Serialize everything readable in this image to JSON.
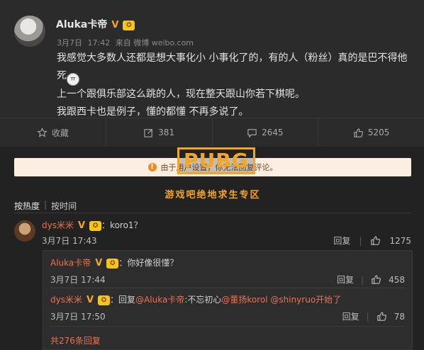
{
  "post": {
    "author": "Aluka卡帝",
    "verified_badge": "V",
    "game_badge": "✪",
    "date": "3月7日",
    "time": "17:42",
    "source": "来自 微博 weibo.com",
    "lines": [
      "我感觉大多数人还都是想大事化小 小事化了的，有的人（粉丝）真的是巴不得他",
      "死",
      "上一个跟俱乐部这么跳的人，现在整天跟山你若下棋呢。",
      "我跟西卡也是例子，懂的都懂 不再多说了。"
    ]
  },
  "actions": {
    "favorite_label": "收藏",
    "repost_count": "381",
    "comment_count": "2645",
    "like_count": "5205"
  },
  "notice": {
    "text": "由于用户设置，你无法回复评论。",
    "icon": "alert-icon"
  },
  "watermark": {
    "logo": "PUBG",
    "caption": "游戏吧绝地求生专区"
  },
  "sort": {
    "by_hot": "按热度",
    "by_time": "按时间"
  },
  "comments": [
    {
      "user": "dys米米",
      "text": "：koro1？",
      "date": "3月7日",
      "time": "17:43",
      "reply_label": "回复",
      "likes": "1275"
    }
  ],
  "replies": [
    {
      "user": "Aluka卡帝",
      "text": "：你好像很懂？",
      "date": "3月7日",
      "time": "17:44",
      "reply_label": "回复",
      "likes": "458"
    },
    {
      "user": "dys米米",
      "prefix": "：回复",
      "mention1": "@Aluka卡帝",
      "middle": ":不忘初心",
      "mention2": "@董扬korol",
      "mention3": "@shinyruo开始了",
      "date": "3月7日",
      "time": "17:50",
      "reply_label": "回复",
      "likes": "78"
    }
  ],
  "more_replies": "共276条回复",
  "colors": {
    "accent": "#eb7350",
    "watermark": "#f5a524",
    "background": "#222222"
  }
}
